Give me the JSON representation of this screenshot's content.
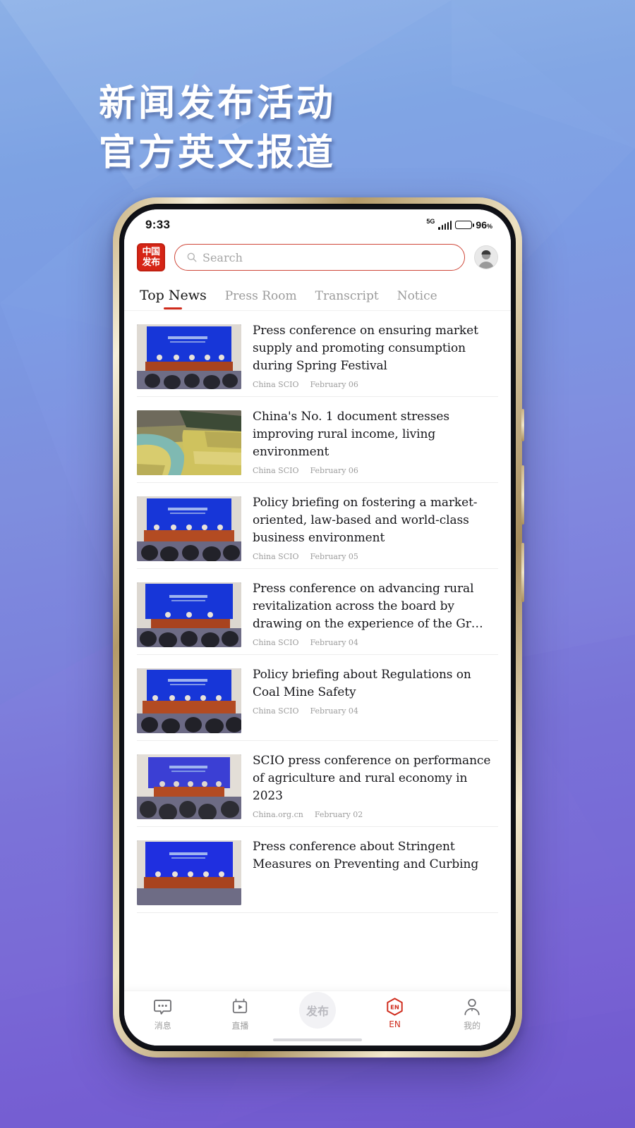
{
  "poster": {
    "headline_line1": "新闻发布活动",
    "headline_line2": "官方英文报道",
    "bg_top_color": "#8fb3e8",
    "bg_bottom_color": "#7258cf"
  },
  "status_bar": {
    "time": "9:33",
    "network": "5G",
    "battery_percent": "96",
    "percent_sign": "%"
  },
  "app_header": {
    "logo_line1": "中国",
    "logo_line2": "发布",
    "search_placeholder": "Search",
    "search_value": "",
    "accent_color": "#cf2b1c"
  },
  "tabs": [
    {
      "label": "Top News",
      "active": true
    },
    {
      "label": "Press Room",
      "active": false
    },
    {
      "label": "Transcript",
      "active": false
    },
    {
      "label": "Notice",
      "active": false
    }
  ],
  "articles": [
    {
      "title": "Press conference on ensuring market supply and promoting consumption during Spring Festival",
      "source": "China SCIO",
      "date": "February 06",
      "thumb": "press-conference-blue-backdrop"
    },
    {
      "title": "China's No. 1 document stresses improving rural income, living environment",
      "source": "China SCIO",
      "date": "February 06",
      "thumb": "rural-river-farmland-aerial"
    },
    {
      "title": "Policy briefing on fostering a market-oriented, law-based and world-class business environment",
      "source": "China SCIO",
      "date": "February 05",
      "thumb": "press-conference-blue-backdrop"
    },
    {
      "title": "Press conference on advancing rural revitalization across the board by drawing on the experience of the Gr…",
      "source": "China SCIO",
      "date": "February 04",
      "thumb": "press-conference-blue-backdrop"
    },
    {
      "title": "Policy briefing about Regulations on Coal Mine Safety",
      "source": "China SCIO",
      "date": "February 04",
      "thumb": "press-conference-blue-backdrop"
    },
    {
      "title": "SCIO press conference on performance of agriculture and rural economy in 2023",
      "source": "China.org.cn",
      "date": "February 02",
      "thumb": "press-conference-blue-backdrop"
    },
    {
      "title": "Press conference about Stringent Measures on Preventing and Curbing",
      "source": "",
      "date": "",
      "thumb": "press-conference-blue-backdrop"
    }
  ],
  "bottom_nav": {
    "items": [
      {
        "label": "消息",
        "icon": "message-bubble-icon",
        "active": false
      },
      {
        "label": "直播",
        "icon": "live-video-icon",
        "active": false
      },
      {
        "label": "发布",
        "icon": "publish-fab-icon",
        "active": false
      },
      {
        "label": "EN",
        "icon": "en-language-icon",
        "active": true
      },
      {
        "label": "我的",
        "icon": "profile-person-icon",
        "active": false
      }
    ],
    "active_color": "#cf2b1c",
    "inactive_color": "#9e9e9e"
  }
}
